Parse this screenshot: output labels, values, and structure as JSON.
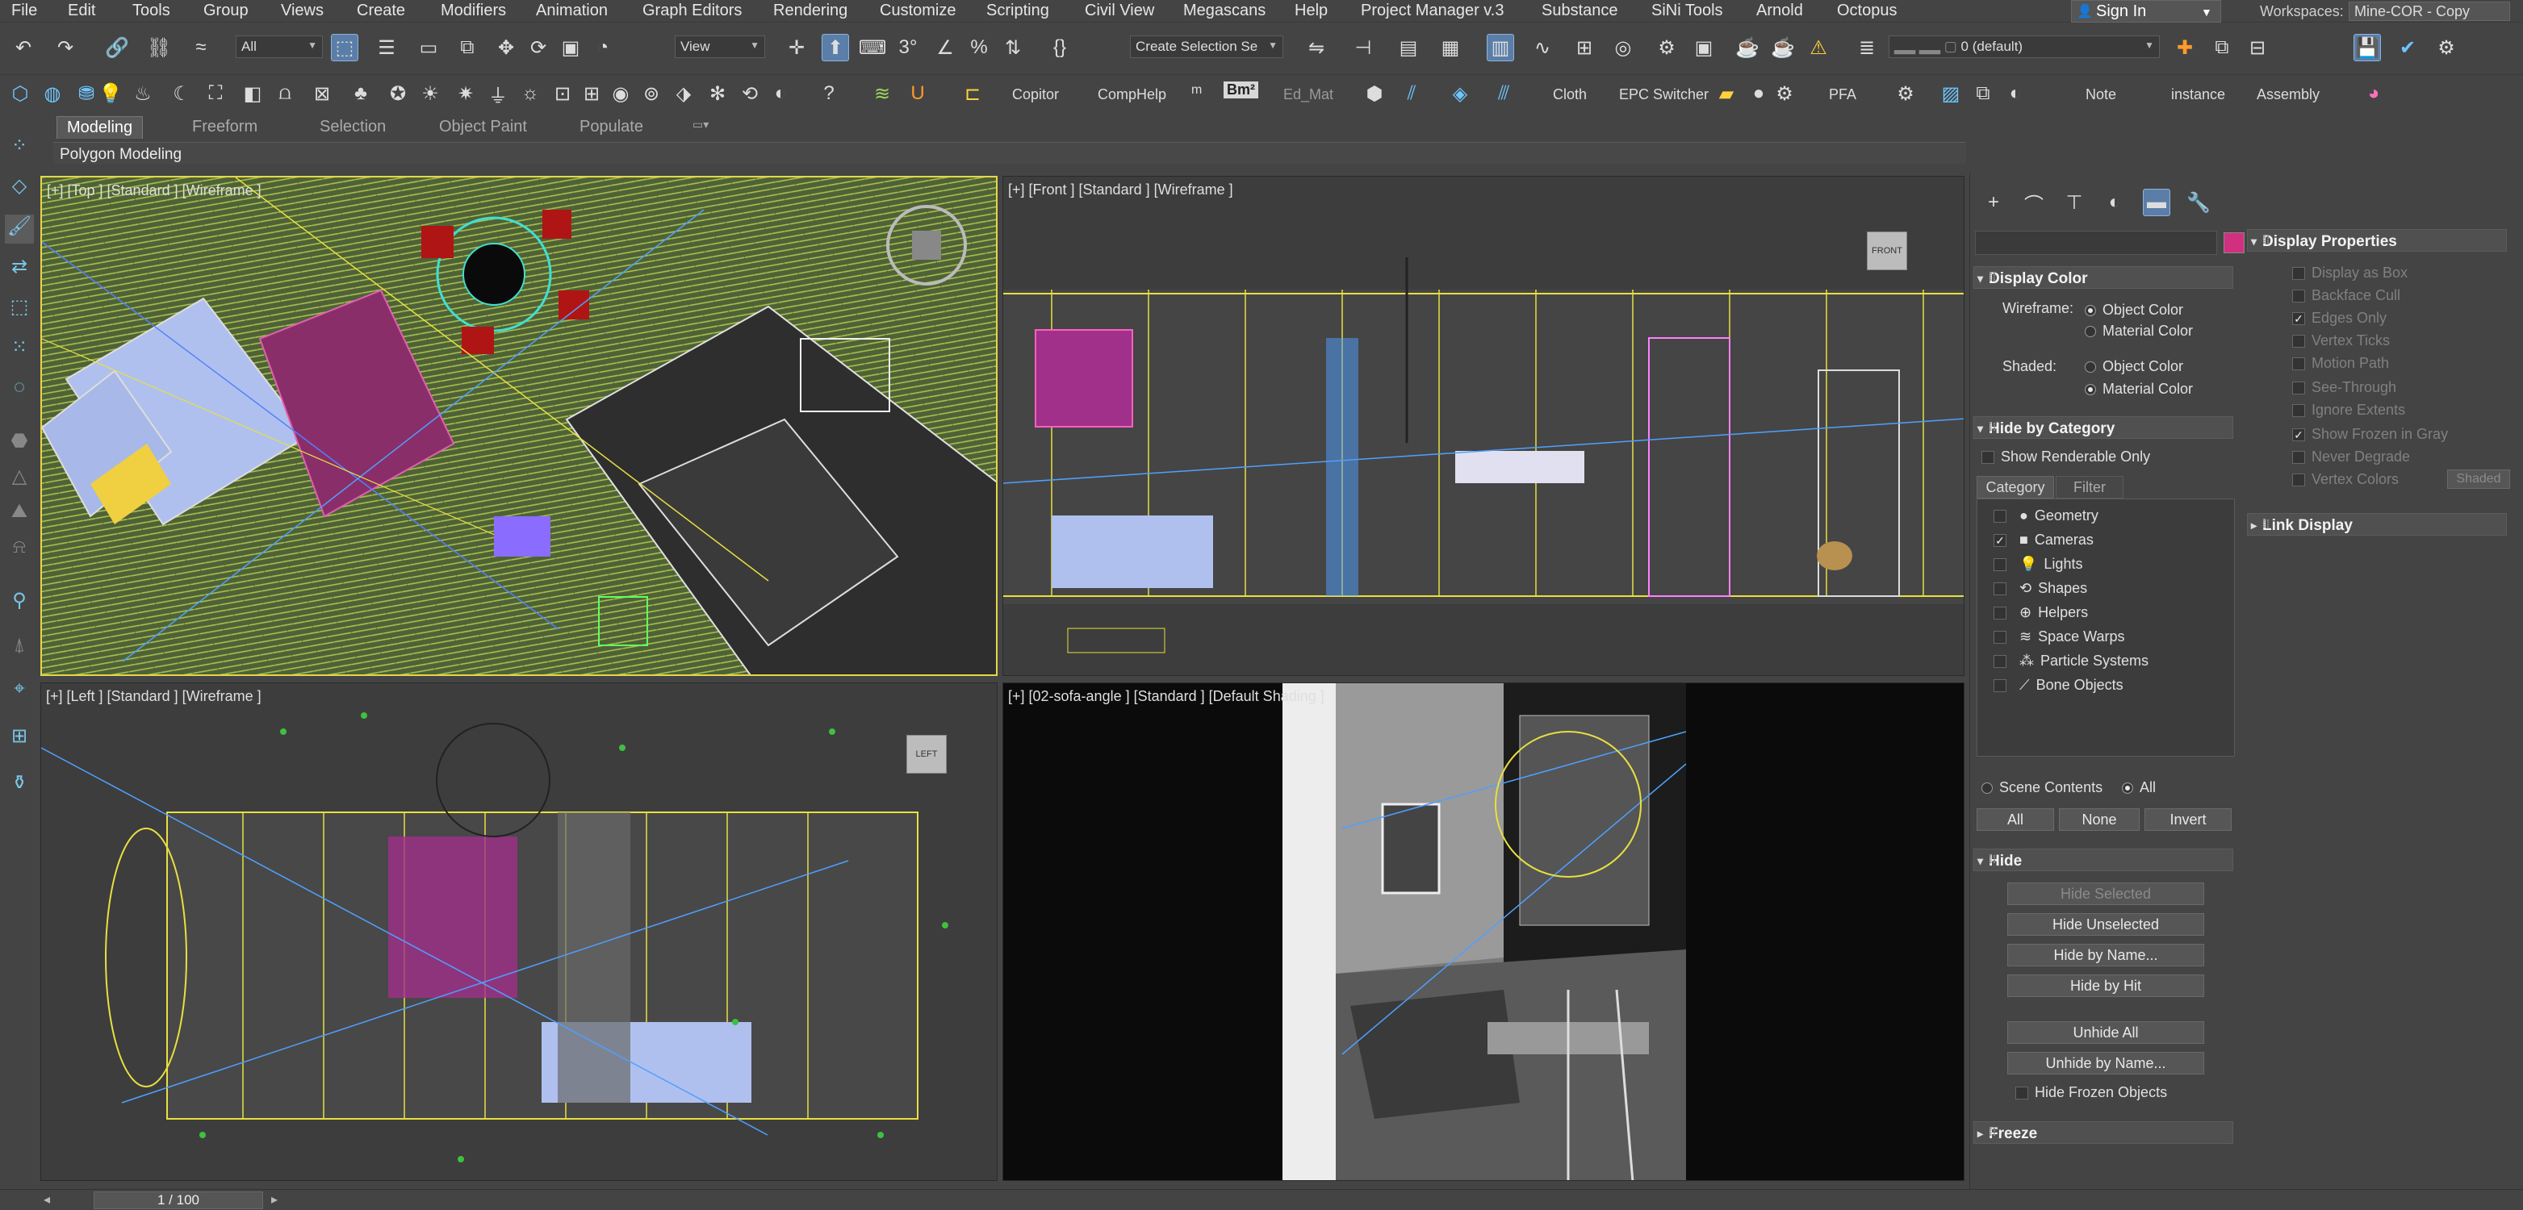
{
  "menu": [
    "File",
    "Edit",
    "Tools",
    "Group",
    "Views",
    "Create",
    "Modifiers",
    "Animation",
    "Graph Editors",
    "Rendering",
    "Customize",
    "Scripting",
    "Civil View",
    "Megascans",
    "Help",
    "Project Manager v.3",
    "Substance",
    "SiNi Tools",
    "Arnold",
    "Octopus"
  ],
  "account": {
    "sign_in": "Sign In",
    "workspaces_label": "Workspaces:",
    "workspace_value": "Mine-COR - Copy"
  },
  "toolbar1": {
    "filter": "All",
    "ref_coord": "View",
    "selection_set": "Create Selection Se",
    "layer": "0 (default)"
  },
  "toolbar2": {
    "labels": [
      "Copitor",
      "CompHelp",
      "Bm²",
      "Ed_Mat",
      "Cloth",
      "EPC Switcher",
      "PFA",
      "Note",
      "instance",
      "Assembly"
    ]
  },
  "ribbon": {
    "tabs": [
      "Modeling",
      "Freeform",
      "Selection",
      "Object Paint",
      "Populate"
    ],
    "active_tab": "Modeling",
    "sub": "Polygon Modeling"
  },
  "viewports": {
    "top": "[+] [Top ] [Standard ] [Wireframe ]",
    "front": "[+] [Front ] [Standard ] [Wireframe ]",
    "left": "[+] [Left ] [Standard ] [Wireframe ]",
    "persp": "[+] [02-sofa-angle ] [Standard ] [Default Shading ]",
    "cube_front": "FRONT",
    "cube_left": "LEFT"
  },
  "display_panel": {
    "display_color": {
      "title": "Display Color",
      "wireframe_label": "Wireframe:",
      "shaded_label": "Shaded:",
      "object_color": "Object Color",
      "material_color": "Material Color"
    },
    "hide_by_category": {
      "title": "Hide by Category",
      "show_renderable": "Show Renderable Only",
      "tabs": [
        "Category",
        "Filter"
      ],
      "items": [
        {
          "label": "Geometry",
          "checked": false
        },
        {
          "label": "Cameras",
          "checked": true
        },
        {
          "label": "Lights",
          "checked": false
        },
        {
          "label": "Shapes",
          "checked": false
        },
        {
          "label": "Helpers",
          "checked": false
        },
        {
          "label": "Space Warps",
          "checked": false
        },
        {
          "label": "Particle Systems",
          "checked": false
        },
        {
          "label": "Bone Objects",
          "checked": false
        }
      ],
      "scene_contents": "Scene Contents",
      "all_radio": "All",
      "buttons": [
        "All",
        "None",
        "Invert"
      ]
    },
    "hide": {
      "title": "Hide",
      "buttons": [
        "Hide Selected",
        "Hide Unselected",
        "Hide by Name...",
        "Hide by Hit",
        "Unhide All",
        "Unhide by Name..."
      ],
      "hide_frozen": "Hide Frozen Objects"
    },
    "freeze": {
      "title": "Freeze"
    }
  },
  "display_properties": {
    "title": "Display Properties",
    "items": [
      {
        "label": "Display as Box",
        "checked": false
      },
      {
        "label": "Backface Cull",
        "checked": false
      },
      {
        "label": "Edges Only",
        "checked": true
      },
      {
        "label": "Vertex Ticks",
        "checked": false
      },
      {
        "label": "Motion Path",
        "checked": false
      },
      {
        "label": "See-Through",
        "checked": false
      },
      {
        "label": "Ignore Extents",
        "checked": false
      },
      {
        "label": "Show Frozen in Gray",
        "checked": true
      },
      {
        "label": "Never Degrade",
        "checked": false
      },
      {
        "label": "Vertex Colors",
        "checked": false
      }
    ],
    "shaded_btn": "Shaded",
    "link_display": "Link Display"
  },
  "status": {
    "frame": "1 / 100"
  },
  "colors": {
    "accent": "#5a7ea8",
    "active_viewport": "#e5d64a",
    "swatch": "#d0307f"
  }
}
